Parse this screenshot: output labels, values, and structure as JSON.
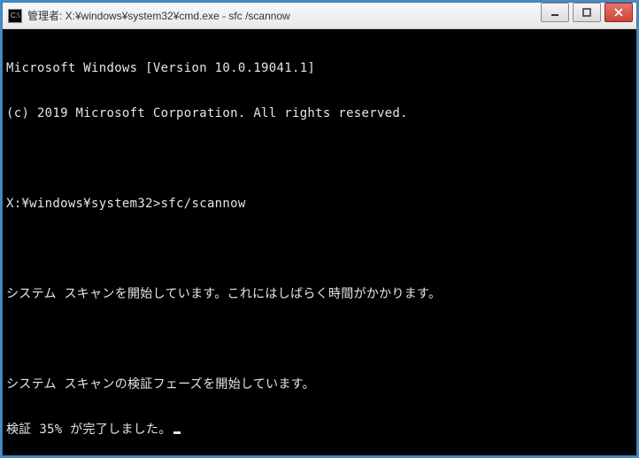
{
  "titlebar": {
    "icon_text": "C:\\",
    "title": "管理者: X:¥windows¥system32¥cmd.exe - sfc  /scannow"
  },
  "terminal": {
    "lines": [
      "Microsoft Windows [Version 10.0.19041.1]",
      "(c) 2019 Microsoft Corporation. All rights reserved.",
      "",
      "X:¥windows¥system32>sfc/scannow",
      "",
      "システム スキャンを開始しています。これにはしばらく時間がかかります。",
      "",
      "システム スキャンの検証フェーズを開始しています。",
      "検証 35% が完了しました。"
    ]
  }
}
